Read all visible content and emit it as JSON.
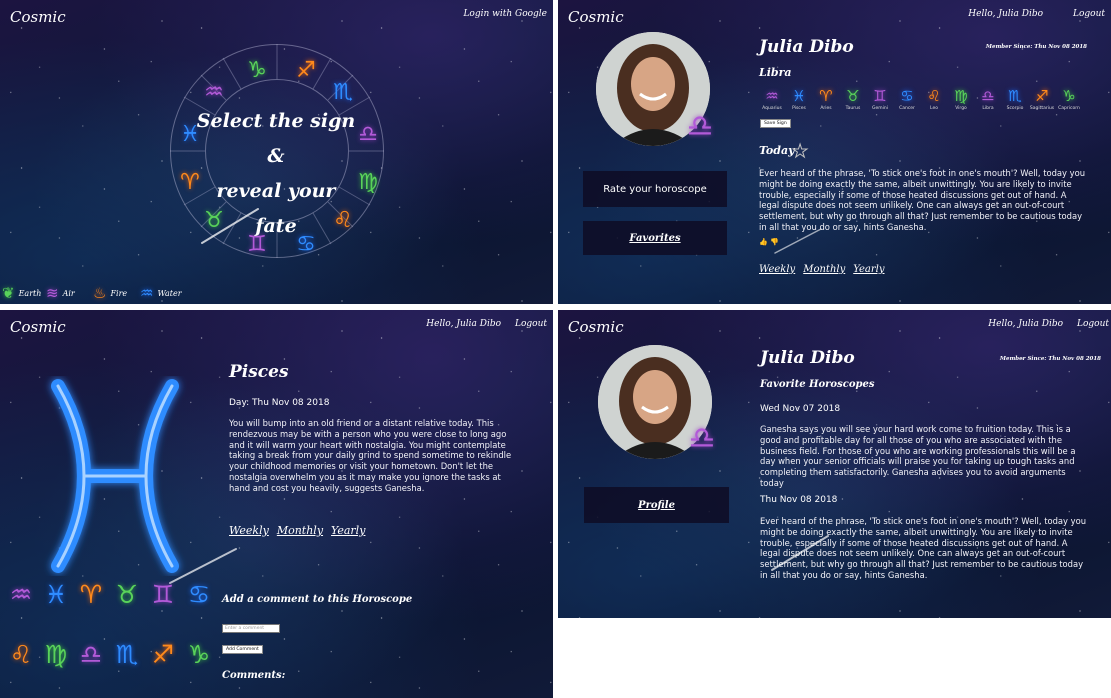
{
  "app_name": "Cosmic",
  "landing": {
    "login_label": "Login with Google",
    "headline": [
      "Select the sign",
      "&",
      "reveal your fate"
    ],
    "legend": [
      {
        "icon": "leaf-icon",
        "label": "Earth"
      },
      {
        "icon": "wind-icon",
        "label": "Air"
      },
      {
        "icon": "flame-icon",
        "label": "Fire"
      },
      {
        "icon": "drop-icon",
        "label": "Water"
      }
    ]
  },
  "nav": {
    "greeting": "Hello, Julia Dibo",
    "logout": "Logout"
  },
  "profile": {
    "name": "Julia Dibo",
    "member_since": "Member Since: Thu Nov 08 2018",
    "sign": "Libra",
    "signs": [
      "Aquarius",
      "Pisces",
      "Aries",
      "Taurus",
      "Gemini",
      "Cancer",
      "Leo",
      "Virgo",
      "Libra",
      "Scorpio",
      "Sagittarius",
      "Capricorn"
    ],
    "save_sign": "Save Sign",
    "today_label": "Today",
    "today_text": "Ever heard of the phrase, 'To stick one's foot in one's mouth'? Well, today you might be doing exactly the same, albeit unwittingly. You are likely to invite trouble, especially if some of those heated discussions get out of hand. A legal dispute does not seem unlikely. One can always get an out-of-court settlement, but why go through all that? Just remember to be cautious today in all that you do or say, hints Ganesha.",
    "reactions": "👍 👎",
    "rate_button": "Rate your horoscope",
    "favorites_button": "Favorites",
    "tabs": [
      "Weekly",
      "Monthly",
      "Yearly"
    ]
  },
  "horoscope": {
    "title": "Pisces",
    "day": "Day: Thu Nov 08 2018",
    "text": "You will bump into an old friend or a distant relative today. This rendezvous may be with a person who you were close to long ago and it will warm your heart with nostalgia. You might contemplate taking a break from your daily grind to spend sometime to rekindle your childhood memories or visit your hometown. Don't let the nostalgia overwhelm you as it may make you ignore the tasks at hand and cost you heavily, suggests Ganesha.",
    "tabs": [
      "Weekly",
      "Monthly",
      "Yearly"
    ],
    "comment_title": "Add a comment to this Horoscope",
    "comment_placeholder": "Enter a comment",
    "add_comment": "Add Comment",
    "comments_label": "Comments:"
  },
  "favorites": {
    "title": "Favorite Horoscopes",
    "entries": [
      {
        "date": "Wed Nov 07 2018",
        "text": "Ganesha says you will see your hard work come to fruition today. This is a good and profitable day for all those of you who are associated with the business field. For those of you who are working professionals this will be a day when your senior officials will praise you for taking up tough tasks and completing them satisfactorily. Ganesha advises you to avoid arguments today"
      },
      {
        "date": "Thu Nov 08 2018",
        "text": "Ever heard of the phrase, 'To stick one's foot in one's mouth'? Well, today you might be doing exactly the same, albeit unwittingly. You are likely to invite trouble, especially if some of those heated discussions get out of hand. A legal dispute does not seem unlikely. One can always get an out-of-court settlement, but why go through all that? Just remember to be cautious today in all that you do or say, hints Ganesha."
      }
    ],
    "profile_button": "Profile"
  },
  "colors": {
    "earth": "#59d35a",
    "air": "#b25ad8",
    "fire": "#ff8a1c",
    "water": "#2f8cff"
  }
}
